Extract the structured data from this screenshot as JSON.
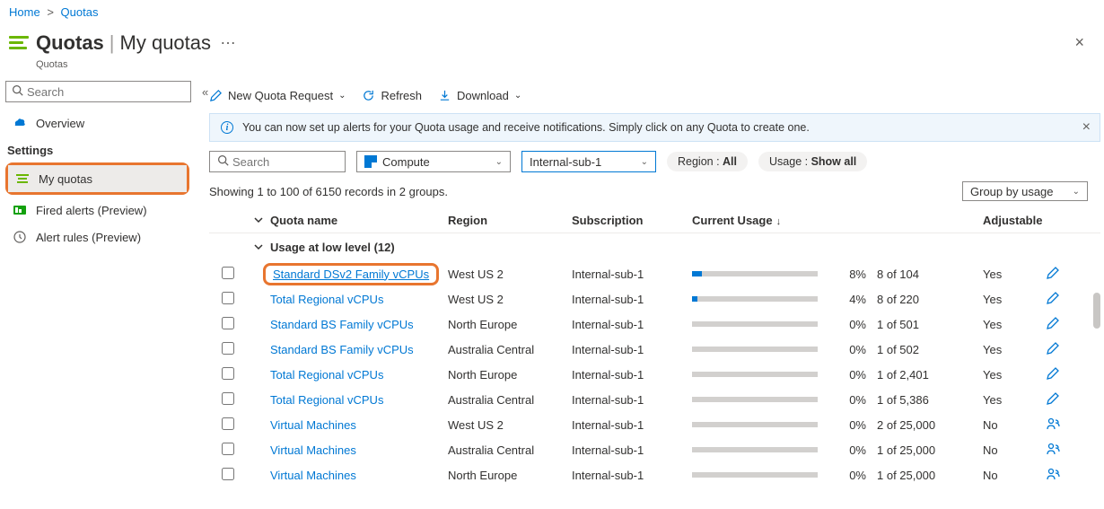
{
  "breadcrumb": {
    "home": "Home",
    "quotas": "Quotas"
  },
  "header": {
    "title_main": "Quotas",
    "title_sub": "My quotas",
    "subtitle": "Quotas",
    "close": "×"
  },
  "sidebar": {
    "search_placeholder": "Search",
    "overview": "Overview",
    "section_settings": "Settings",
    "my_quotas": "My quotas",
    "fired_alerts": "Fired alerts (Preview)",
    "alert_rules": "Alert rules (Preview)"
  },
  "toolbar": {
    "new_quota": "New Quota Request",
    "refresh": "Refresh",
    "download": "Download"
  },
  "banner": {
    "text": "You can now set up alerts for your Quota usage and receive notifications. Simply click on any Quota to create one."
  },
  "filters": {
    "search_placeholder": "Search",
    "provider": "Compute",
    "subscription": "Internal-sub-1",
    "region_label": "Region : ",
    "region_value": "All",
    "usage_label": "Usage : ",
    "usage_value": "Show all"
  },
  "records_text": "Showing 1 to 100 of 6150 records in 2 groups.",
  "group_by": "Group by usage",
  "columns": {
    "name": "Quota name",
    "region": "Region",
    "subscription": "Subscription",
    "usage": "Current Usage",
    "adjustable": "Adjustable"
  },
  "group_header": "Usage at low level (12)",
  "rows": [
    {
      "name": "Standard DSv2 Family vCPUs",
      "region": "West US 2",
      "subscription": "Internal-sub-1",
      "pct": 8,
      "pct_label": "8%",
      "usage_text": "8 of 104",
      "adjustable": "Yes",
      "edit": "pen",
      "highlight": true
    },
    {
      "name": "Total Regional vCPUs",
      "region": "West US 2",
      "subscription": "Internal-sub-1",
      "pct": 4,
      "pct_label": "4%",
      "usage_text": "8 of 220",
      "adjustable": "Yes",
      "edit": "pen"
    },
    {
      "name": "Standard BS Family vCPUs",
      "region": "North Europe",
      "subscription": "Internal-sub-1",
      "pct": 0,
      "pct_label": "0%",
      "usage_text": "1 of 501",
      "adjustable": "Yes",
      "edit": "pen"
    },
    {
      "name": "Standard BS Family vCPUs",
      "region": "Australia Central",
      "subscription": "Internal-sub-1",
      "pct": 0,
      "pct_label": "0%",
      "usage_text": "1 of 502",
      "adjustable": "Yes",
      "edit": "pen"
    },
    {
      "name": "Total Regional vCPUs",
      "region": "North Europe",
      "subscription": "Internal-sub-1",
      "pct": 0,
      "pct_label": "0%",
      "usage_text": "1 of 2,401",
      "adjustable": "Yes",
      "edit": "pen"
    },
    {
      "name": "Total Regional vCPUs",
      "region": "Australia Central",
      "subscription": "Internal-sub-1",
      "pct": 0,
      "pct_label": "0%",
      "usage_text": "1 of 5,386",
      "adjustable": "Yes",
      "edit": "pen"
    },
    {
      "name": "Virtual Machines",
      "region": "West US 2",
      "subscription": "Internal-sub-1",
      "pct": 0,
      "pct_label": "0%",
      "usage_text": "2 of 25,000",
      "adjustable": "No",
      "edit": "person"
    },
    {
      "name": "Virtual Machines",
      "region": "Australia Central",
      "subscription": "Internal-sub-1",
      "pct": 0,
      "pct_label": "0%",
      "usage_text": "1 of 25,000",
      "adjustable": "No",
      "edit": "person"
    },
    {
      "name": "Virtual Machines",
      "region": "North Europe",
      "subscription": "Internal-sub-1",
      "pct": 0,
      "pct_label": "0%",
      "usage_text": "1 of 25,000",
      "adjustable": "No",
      "edit": "person"
    }
  ]
}
